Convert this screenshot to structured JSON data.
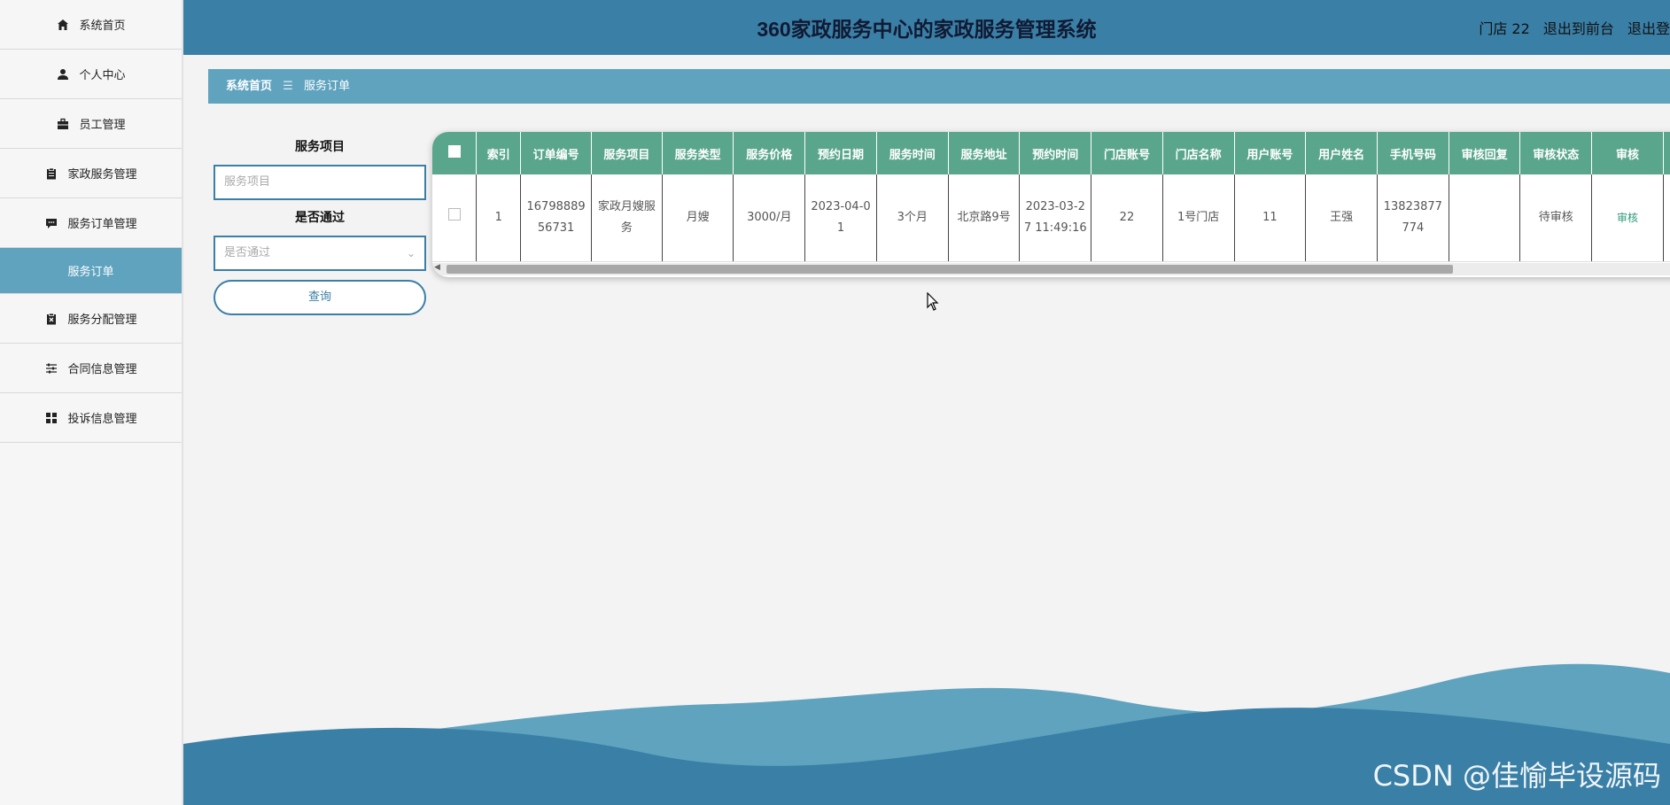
{
  "header": {
    "title": "360家政服务中心的家政服务管理系统",
    "user": "门店 22",
    "front": "退出到前台",
    "logout": "退出登"
  },
  "sidebar": {
    "items": [
      {
        "label": "系统首页",
        "icon": "home-icon"
      },
      {
        "label": "个人中心",
        "icon": "user-icon"
      },
      {
        "label": "员工管理",
        "icon": "briefcase-icon"
      },
      {
        "label": "家政服务管理",
        "icon": "clipboard-icon"
      },
      {
        "label": "服务订单管理",
        "icon": "comment-icon"
      },
      {
        "label": "服务订单",
        "icon": ""
      },
      {
        "label": "服务分配管理",
        "icon": "clipboard-x-icon"
      },
      {
        "label": "合同信息管理",
        "icon": "sliders-icon"
      },
      {
        "label": "投诉信息管理",
        "icon": "grid-icon"
      }
    ]
  },
  "breadcrumb": {
    "home": "系统首页",
    "sep": "☰",
    "current": "服务订单"
  },
  "search": {
    "item_label": "服务项目",
    "item_placeholder": "服务项目",
    "pass_label": "是否通过",
    "pass_placeholder": "是否通过",
    "query_button": "查询"
  },
  "table": {
    "columns": [
      "索引",
      "订单编号",
      "服务项目",
      "服务类型",
      "服务价格",
      "预约日期",
      "服务时间",
      "服务地址",
      "预约时间",
      "门店账号",
      "门店名称",
      "用户账号",
      "用户姓名",
      "手机号码",
      "审核回复",
      "审核状态",
      "审核"
    ],
    "rows": [
      [
        "1",
        "1679888956731",
        "家政月嫂服务",
        "月嫂",
        "3000/月",
        "2023-04-01",
        "3个月",
        "北京路9号",
        "2023-03-27 11:49:16",
        "22",
        "1号门店",
        "11",
        "王强",
        "13823877774",
        "",
        "待审核",
        "审核"
      ]
    ]
  },
  "colors": {
    "header": "#3a7fa6",
    "accent": "#5fa3bf",
    "table_head": "#5aa68d"
  },
  "watermark": "CSDN @佳愉毕设源码"
}
